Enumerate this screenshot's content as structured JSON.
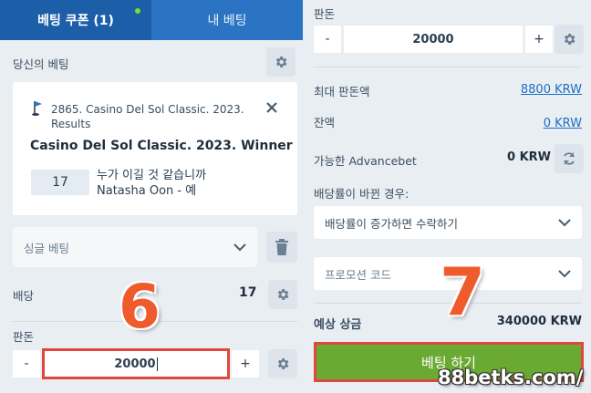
{
  "tabs": {
    "coupon": "베팅 쿠폰 (1)",
    "my_bets": "내 베팅"
  },
  "left": {
    "your_bets_label": "당신의 베팅",
    "event": {
      "line1": "2865. Casino Del Sol Classic. 2023.",
      "line2": "Results",
      "title": "Casino Del Sol Classic. 2023. Winner",
      "odds": "17",
      "question": "누가 이길 것 같습니까",
      "selection": "Natasha Oon - 예"
    },
    "bet_type": "싱글 베팅",
    "odds_label": "배당",
    "odds_value": "17",
    "stake_label": "판돈",
    "minus": "-",
    "plus": "+",
    "stake_value": "20000"
  },
  "right": {
    "stake_label": "판돈",
    "minus": "-",
    "plus": "+",
    "stake_value": "20000",
    "max_stake_label": "최대 판돈액",
    "max_stake_value": "8800 KRW",
    "balance_label": "잔액",
    "balance_value": "0 KRW",
    "advancebet_label": "가능한 Advancebet",
    "advancebet_value": "0 KRW",
    "odds_change_label": "배당률이 바뀐 경우:",
    "odds_change_option": "배당률이 증가하면 수락하기",
    "promo_placeholder": "프로모션 코드",
    "expected_win_label": "예상 상금",
    "expected_win_value": "340000 KRW",
    "place_bet": "베팅 하기"
  },
  "annotations": {
    "step6": "6",
    "step7": "7",
    "watermark": "88betks.com/"
  },
  "colors": {
    "primary": "#1c5fa8",
    "accent_green": "#6aaa32",
    "highlight_red": "#e0473a",
    "link": "#1c6fc4"
  },
  "icons": [
    "gear-icon",
    "close-icon",
    "golf-flag-icon",
    "chevron-down-icon",
    "trash-icon",
    "refresh-icon"
  ]
}
